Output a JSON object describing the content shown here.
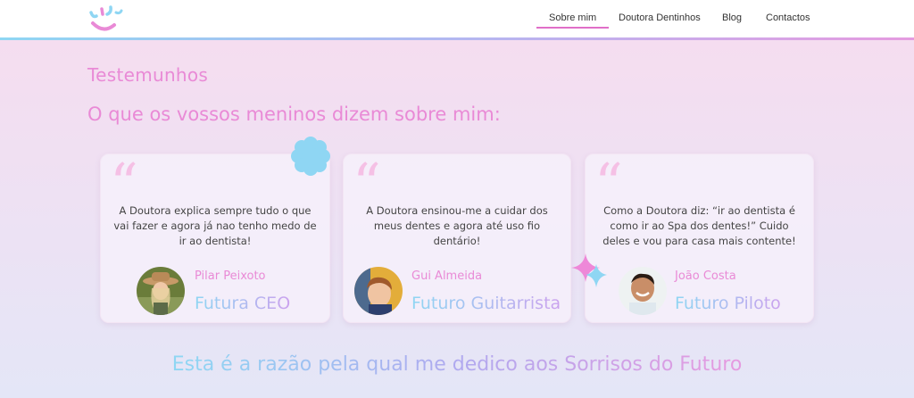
{
  "nav": {
    "items": [
      {
        "label": "Sobre mim",
        "active": true
      },
      {
        "label": "Doutora Dentinhos",
        "active": false
      },
      {
        "label": "Blog",
        "active": false
      },
      {
        "label": "Contactos",
        "active": false
      }
    ]
  },
  "section": {
    "title": "Testemunhos",
    "subtitle": "O que os vossos meninos dizem sobre mim:"
  },
  "testimonials": [
    {
      "quote_mark": "“",
      "text": "A Doutora explica sempre tudo o que vai fazer e agora já nao tenho medo de ir ao dentista!",
      "name": "Pilar Peixoto",
      "role": "Futura CEO",
      "avatar_icon": "child-girl-hat-avatar"
    },
    {
      "quote_mark": "“",
      "text": "A Doutora ensinou-me a cuidar dos meus dentes e agora até uso fio dentário!",
      "name": "Gui Almeida",
      "role": "Futuro Guitarrista",
      "avatar_icon": "child-boy-avatar"
    },
    {
      "quote_mark": "“",
      "text": "Como a Doutora diz: “ir ao dentista é como ir ao Spa dos dentes!” Cuido deles e vou para casa mais contente!",
      "name": "João Costa",
      "role": "Futuro Piloto",
      "avatar_icon": "child-boy-smiling-avatar"
    }
  ],
  "footer": {
    "tagline": "Esta é a razão pela qual me dedico aos Sorrisos do Futuro"
  },
  "colors": {
    "accent_pink": "#e98ad6",
    "accent_blue": "#8fd6f3",
    "accent_lilac": "#b0a9ef"
  }
}
